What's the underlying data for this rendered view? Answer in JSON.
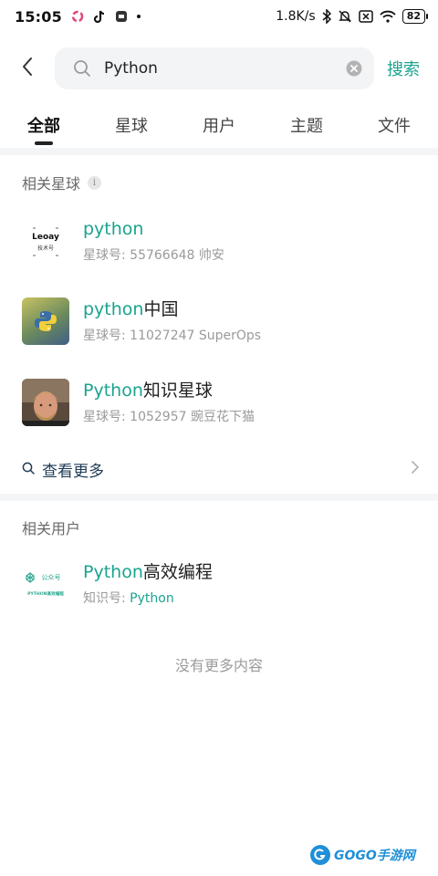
{
  "status_bar": {
    "time": "15:05",
    "net_speed": "1.8K/s",
    "battery": "82"
  },
  "search": {
    "query": "Python",
    "submit_label": "搜索"
  },
  "tabs": [
    {
      "label": "全部",
      "active": true
    },
    {
      "label": "星球",
      "active": false
    },
    {
      "label": "用户",
      "active": false
    },
    {
      "label": "主题",
      "active": false
    },
    {
      "label": "文件",
      "active": false
    }
  ],
  "related_planets": {
    "title": "相关星球",
    "info_glyph": "i",
    "items": [
      {
        "name_hl": "python",
        "name_rest": "",
        "meta": "星球号: 55766648   帅安"
      },
      {
        "name_hl": "python",
        "name_rest": "中国",
        "meta": "星球号: 11027247   SuperOps"
      },
      {
        "name_hl": "Python",
        "name_rest": "知识星球",
        "meta": "星球号: 1052957   豌豆花下猫"
      }
    ],
    "more_label": "查看更多"
  },
  "related_users": {
    "title": "相关用户",
    "items": [
      {
        "name_hl": "Python",
        "name_rest": "高效编程",
        "meta_prefix": "知识号: ",
        "meta_hl": "Python"
      }
    ]
  },
  "avatar_texts": {
    "leoay_top": "Leoay",
    "leoay_bottom": "技术号",
    "pyeff_top": "公众号",
    "pyeff_bottom": "PYTHON高效编程"
  },
  "footer": "没有更多内容",
  "watermark": {
    "text": "GOGO手游网"
  },
  "colors": {
    "accent": "#1aa38f",
    "link_dark": "#1f3b55",
    "muted": "#9a9a9a"
  }
}
